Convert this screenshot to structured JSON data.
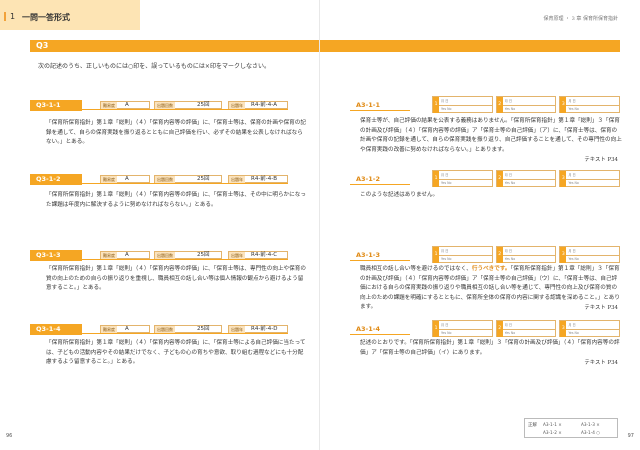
{
  "chapter": {
    "number": "1",
    "title": "一問一答形式"
  },
  "running_head": "保育原理 ・ 3 章 保育所保育指針",
  "section_label": "Q3",
  "instruction": "次の記述のうち、正しいものには○印を、誤っているものには×印をマークしなさい。",
  "meta_labels": {
    "difficulty": "難易度",
    "importance": "出題回数",
    "year": "出題年"
  },
  "questions": [
    {
      "id": "Q3-1-1",
      "difficulty": "A",
      "count": "25回",
      "year": "R4-前-4-A",
      "text": "「保育所保育指針」第１章「総則」（４）「保育内容等の評価」に、「保育士等は、保育の計画や保育の記録を通して、自らの保育実践を振り返るとともに自己評価を行い、必ずその結果を公表しなければならない。」とある。"
    },
    {
      "id": "Q3-1-2",
      "difficulty": "A",
      "count": "25回",
      "year": "R4-前-4-B",
      "text": "「保育所保育指針」第１章「総則」（４）「保育内容等の評価」に、「保育士等は、その中に明らかになった課題は年度内に解決するように努めなければならない。」とある。"
    },
    {
      "id": "Q3-1-3",
      "difficulty": "A",
      "count": "25回",
      "year": "R4-前-4-C",
      "text": "「保育所保育指針」第１章「総則」（４）「保育内容等の評価」に、「保育士等は、専門性の向上や保育の質の向上のための自らの振り返りを重視し、職員相互の話し合い等は個人情報の観点から避けるよう留意すること。」とある。"
    },
    {
      "id": "Q3-1-4",
      "difficulty": "A",
      "count": "25回",
      "year": "R4-前-4-D",
      "text": "「保育所保育指針」第１章「総則」（４）「保育内容等の評価」に、「保育士等による自己評価に当たっては、子どもの活動内容やその結果だけでなく、子どもの心の育ちや意欲、取り組む過程などにも十分配慮するよう留意すること。」とある。"
    }
  ],
  "answers": [
    {
      "id": "A3-1-1",
      "text": "保育士等が、自己評価の結果を公表する義務はありません。「保育所保育指針」第１章「総則」３「保育の計画及び評価」（４）「保育内容等の評価」ア「保育士等の自己評価」（ア）に、「保育士等は、保育の計画や保育の記録を通して、自らの保育実践を振り返り、自己評価することを通して、その専門性の向上や保育実践の改善に努めなければならない。」とあります。",
      "source": "テキスト P34"
    },
    {
      "id": "A3-1-2",
      "text": "このような記述はありません。",
      "source": ""
    },
    {
      "id": "A3-1-3",
      "text_before": "職員相互の話し合い等を避けるのではなく、",
      "emphasis": "行うべきです。",
      "text_after": "「保育所保育指針」第１章「総則」３「保育の計画及び評価」（４）「保育内容等の評価」ア「保育士等の自己評価」（ウ）に、「保育士等は、自己評価における自らの保育実践の振り返りや職員相互の話し合い等を通じて、専門性の向上及び保育の質の向上のための課題を明確にするとともに、保育所全体の保育の内容に関する認識を深めること。」とあります。",
      "source": "テキスト P34"
    },
    {
      "id": "A3-1-4",
      "text": "記述のとおりです。「保育所保育指針」第１章「総則」３「保育の計画及び評価」（４）「保育内容等の評価」ア「保育士等の自己評価」（イ）にあります。",
      "source": "テキスト P34"
    }
  ],
  "check_labels": {
    "date_row": "月 日",
    "mark_row": "Yes No"
  },
  "answer_key": {
    "label": "正解",
    "items": [
      {
        "id": "A3-1-1",
        "mark": "×"
      },
      {
        "id": "A3-1-2",
        "mark": "×"
      },
      {
        "id": "A3-1-3",
        "mark": "×"
      },
      {
        "id": "A3-1-4",
        "mark": "○"
      }
    ]
  },
  "page_numbers": {
    "left": "96",
    "right": "97"
  },
  "colors": {
    "accent": "#f5a623",
    "tab": "#fde4b4"
  }
}
